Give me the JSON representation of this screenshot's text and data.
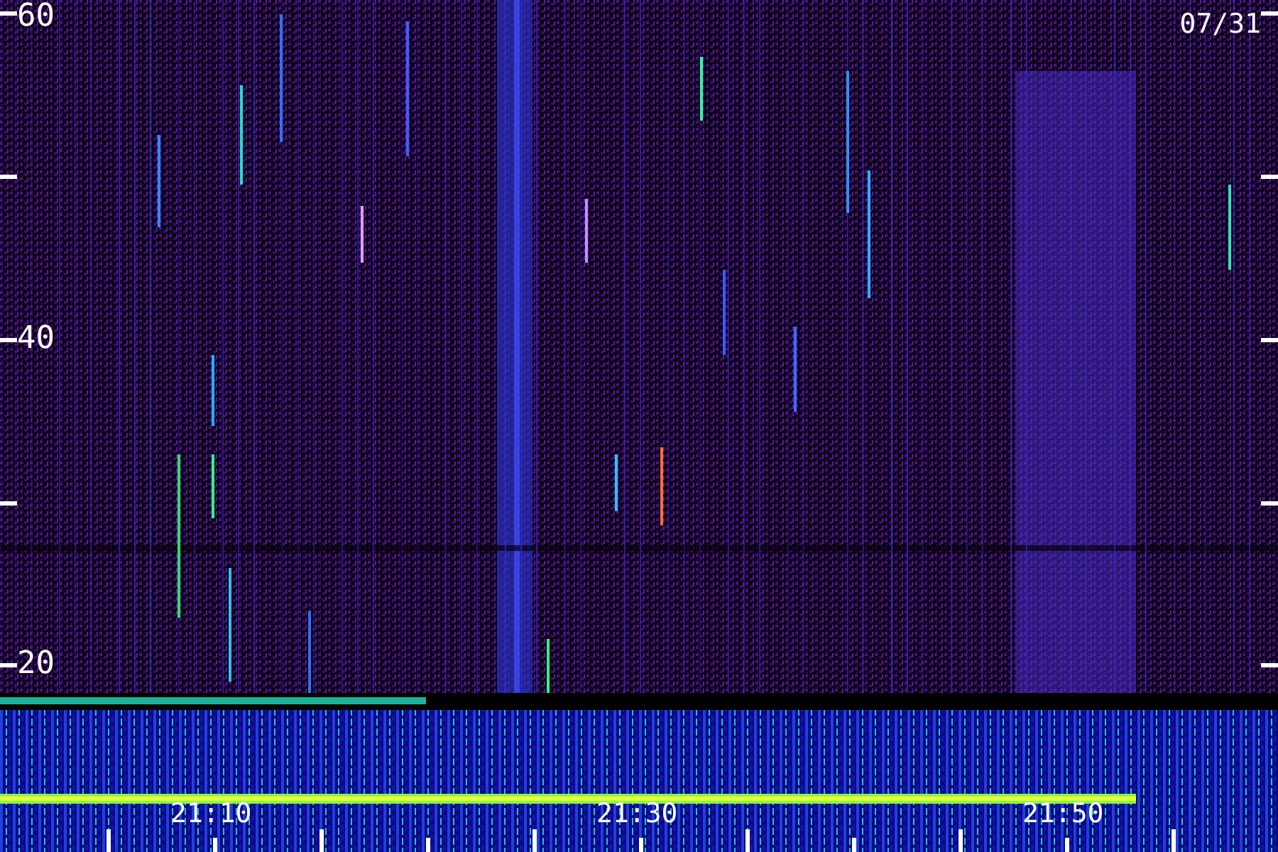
{
  "date": "07/31",
  "y_axis": {
    "labels": [
      "60",
      "40",
      "20"
    ]
  },
  "x_axis": {
    "labels": [
      "21:10",
      "21:30",
      "21:50"
    ]
  }
}
